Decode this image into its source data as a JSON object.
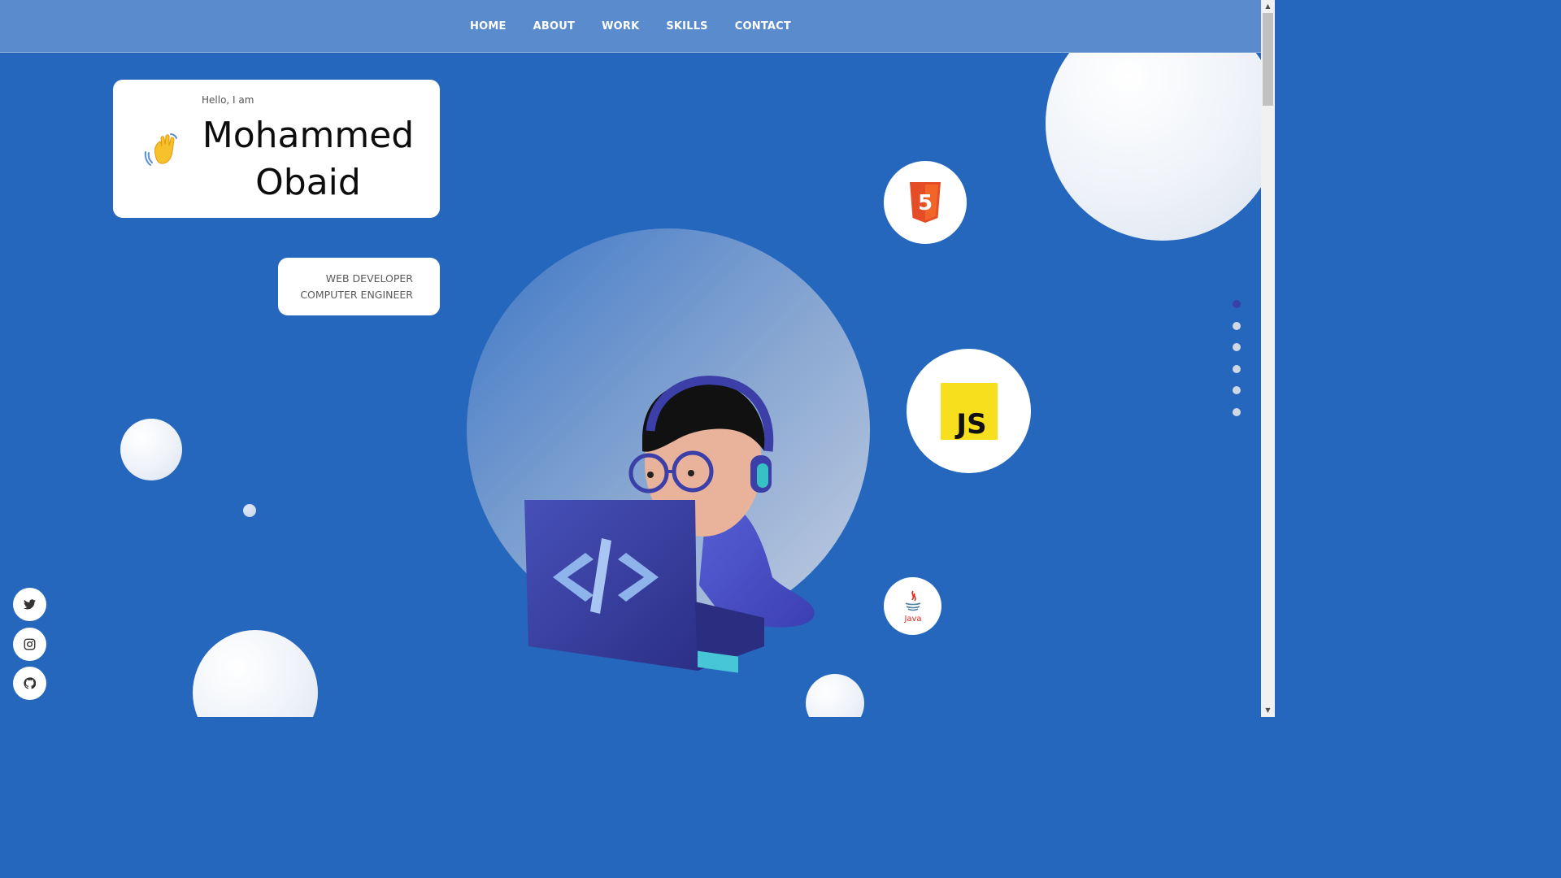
{
  "nav": {
    "items": [
      "HOME",
      "ABOUT",
      "WORK",
      "SKILLS",
      "CONTACT"
    ]
  },
  "intro": {
    "greeting": "Hello, I am",
    "name_first": "Mohammed",
    "name_last": "Obaid"
  },
  "roles": {
    "line1": "WEB DEVELOPER",
    "line2": "COMPUTER ENGINEER"
  },
  "skills": {
    "html_number": "5",
    "js_label": "JS",
    "java_label": "Java"
  },
  "section_dots": {
    "count": 6,
    "active_index": 0
  },
  "social": [
    "twitter-icon",
    "instagram-icon",
    "github-icon"
  ],
  "colors": {
    "background": "#2467bd",
    "navbar": "#5a8ccd",
    "html5": "#e44d26",
    "js": "#f7df1e",
    "java_red": "#e1251b",
    "active_dot": "#3b3fa8"
  }
}
